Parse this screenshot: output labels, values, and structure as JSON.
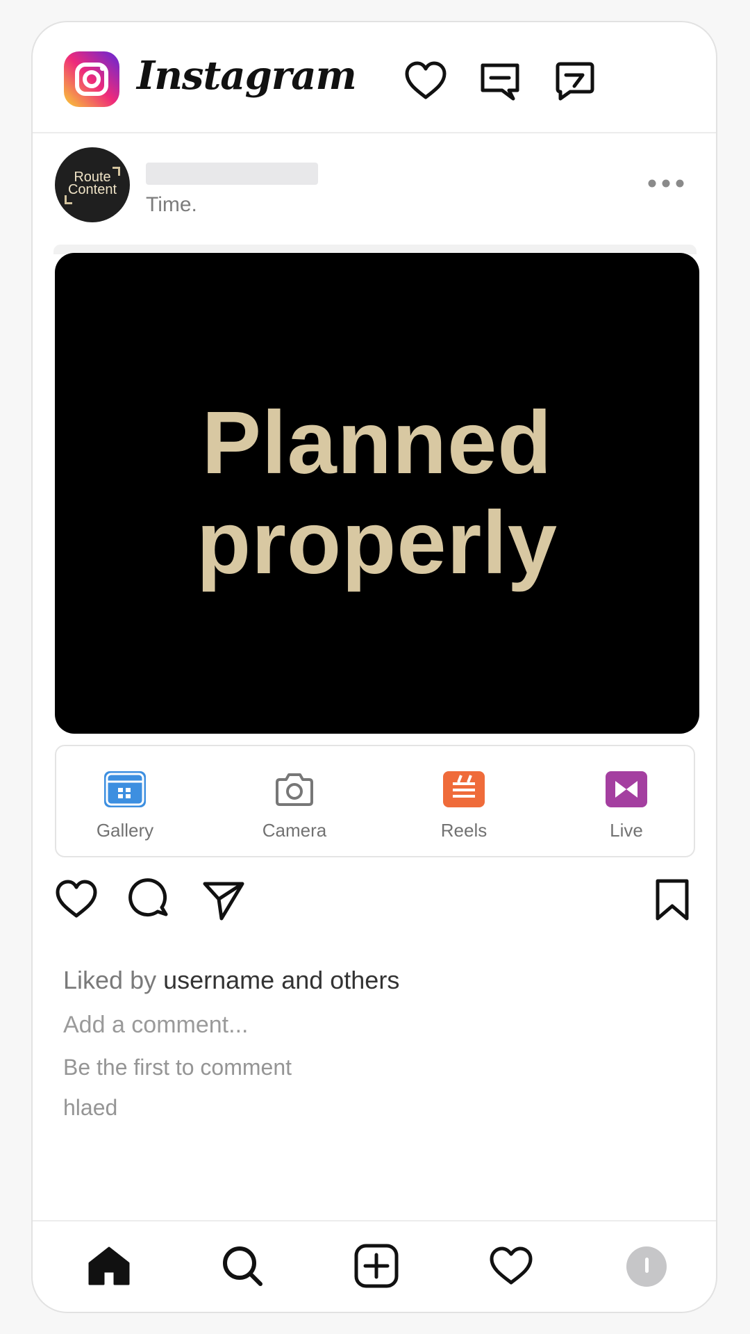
{
  "header": {
    "brand": "Instagram",
    "icons": [
      "instagram-logo-icon",
      "heart-icon",
      "messenger-icon",
      "direct-message-icon"
    ]
  },
  "post": {
    "avatar_text_line1": "Route",
    "avatar_text_line2": "Content",
    "time": "Time.",
    "image_text_line1": "Planned",
    "image_text_line2": "properly",
    "image_text_color": "#d8c8a2"
  },
  "create_panel": {
    "items": [
      {
        "label": "Gallery",
        "icon": "gallery-icon",
        "color": "#3d8fe0"
      },
      {
        "label": "Camera",
        "icon": "camera-icon",
        "color": "#777777"
      },
      {
        "label": "Reels",
        "icon": "reels-icon",
        "color": "#ef6b3a"
      },
      {
        "label": "Live",
        "icon": "live-icon",
        "color": "#a43fa0"
      }
    ]
  },
  "engagement": {
    "liked_prefix": "Liked by",
    "liked_names": "username and others",
    "add_comment_placeholder": "Add a comment...",
    "first_comment": "Be the first to comment",
    "tag": "hlaed"
  },
  "bottom_nav": {
    "items": [
      "home-icon",
      "search-icon",
      "create-icon",
      "activity-icon",
      "profile-icon"
    ]
  }
}
